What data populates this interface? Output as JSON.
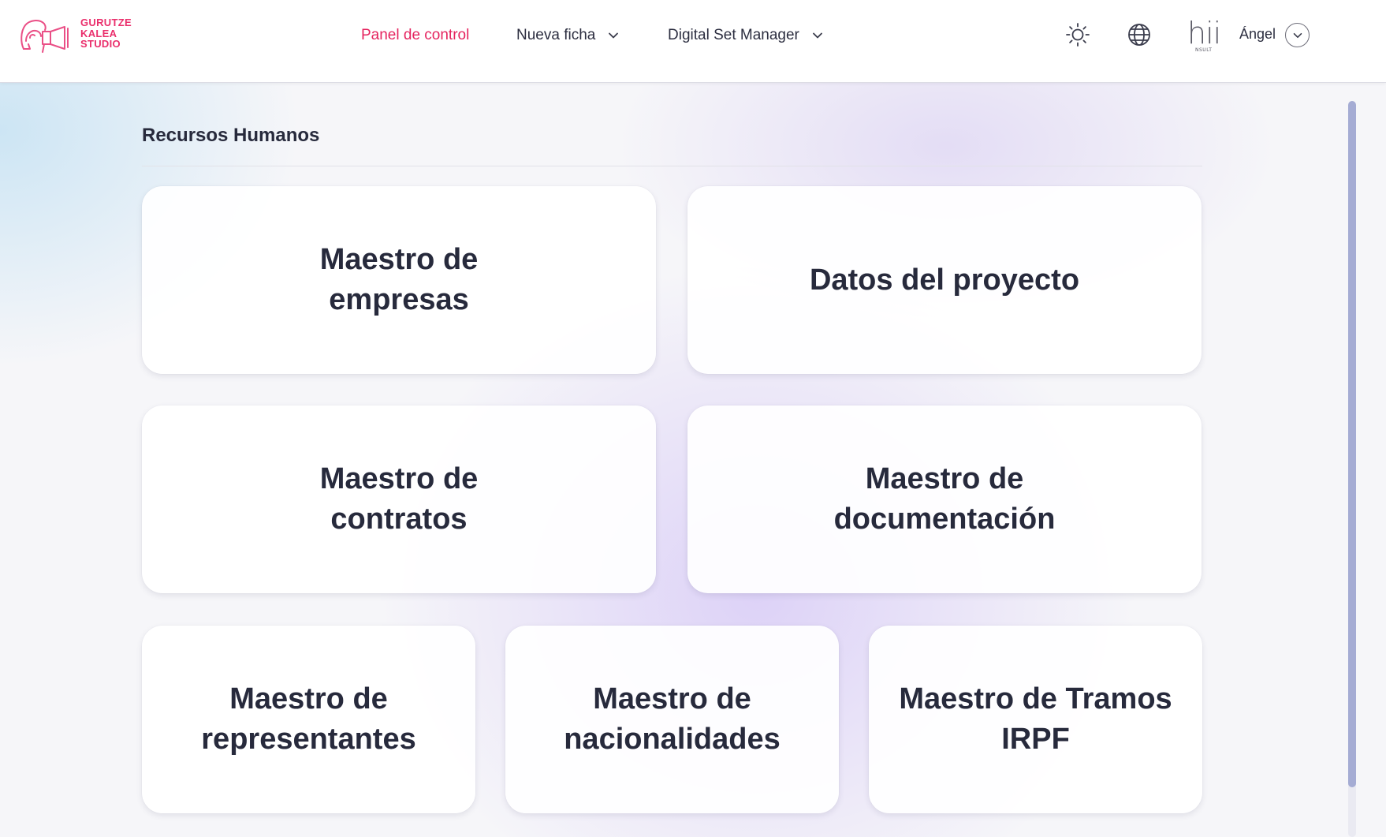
{
  "header": {
    "logo": {
      "lines": [
        "GURUTZE",
        "KALEA",
        "STUDIO"
      ]
    },
    "nav": [
      {
        "label": "Panel de control",
        "active": true,
        "has_dropdown": false
      },
      {
        "label": "Nueva ficha",
        "active": false,
        "has_dropdown": true
      },
      {
        "label": "Digital Set Manager",
        "active": false,
        "has_dropdown": true
      }
    ],
    "icons": [
      "sun-icon",
      "globe-icon"
    ],
    "user": {
      "logo_text": "hii",
      "logo_subtext": "NSULT",
      "name": "Ángel"
    }
  },
  "main": {
    "section_title": "Recursos Humanos",
    "cards": [
      {
        "label": "Maestro de empresas"
      },
      {
        "label": "Datos del proyecto"
      },
      {
        "label": "Maestro de contratos"
      },
      {
        "label": "Maestro de documentación"
      },
      {
        "label": "Maestro de representantes"
      },
      {
        "label": "Maestro de nacionalidades"
      },
      {
        "label": "Maestro de Tramos IRPF"
      }
    ]
  },
  "colors": {
    "accent": "#e5245f",
    "text": "#272a3c",
    "scrollbar": "#a5acd4"
  }
}
